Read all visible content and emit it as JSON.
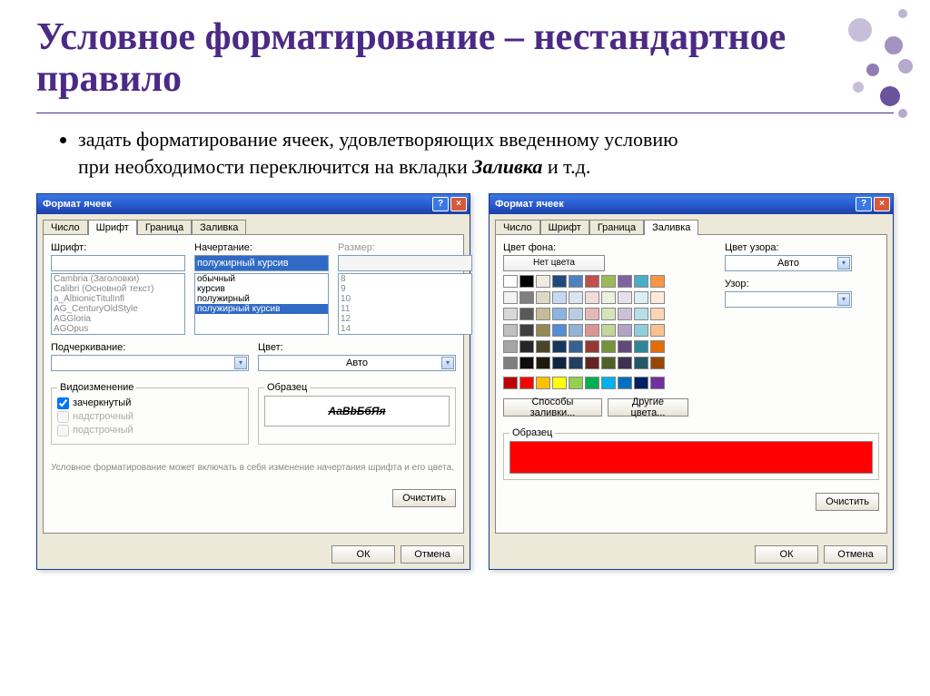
{
  "slide": {
    "title": "Условное форматирование – нестандартное правило",
    "bullet_line1": "задать форматирование ячеек, удовлетворяющих введенному условию",
    "bullet_line2": "при необходимости переключится на вкладки ",
    "bullet_emph": "Заливка",
    "bullet_tail": " и т.д."
  },
  "dialog_font": {
    "title": "Формат ячеек",
    "tabs": [
      "Число",
      "Шрифт",
      "Граница",
      "Заливка"
    ],
    "active_tab": 1,
    "font_label": "Шрифт:",
    "font_value": "",
    "font_list": [
      "Cambria (Заголовки)",
      "Calibri (Основной текст)",
      "a_AlbionicTitulInfl",
      "AG_CenturyOldStyle",
      "AGGloria",
      "AGOpus"
    ],
    "style_label": "Начертание:",
    "style_value": "полужирный курсив",
    "style_list": [
      "обычный",
      "курсив",
      "полужирный",
      "полужирный курсив"
    ],
    "size_label": "Размер:",
    "size_value": "",
    "size_list": [
      "8",
      "9",
      "10",
      "11",
      "12",
      "14"
    ],
    "underline_label": "Подчеркивание:",
    "underline_value": "",
    "color_label": "Цвет:",
    "color_value": "Авто",
    "effects_label": "Видоизменение",
    "effects": {
      "strike": "зачеркнутый",
      "super": "надстрочный",
      "sub": "подстрочный"
    },
    "sample_label": "Образец",
    "sample_text": "АаВbБбЯя",
    "note": "Условное форматирование может включать в себя изменение начертания шрифта и его цвета.",
    "clear_btn": "Очистить",
    "ok": "ОК",
    "cancel": "Отмена"
  },
  "dialog_fill": {
    "title": "Формат ячеек",
    "tabs": [
      "Число",
      "Шрифт",
      "Граница",
      "Заливка"
    ],
    "active_tab": 3,
    "bgcolor_label": "Цвет фона:",
    "nocolor": "Нет цвета",
    "pattern_color_label": "Цвет узора:",
    "pattern_color_value": "Авто",
    "pattern_label": "Узор:",
    "pattern_value": "",
    "fill_methods_btn": "Способы заливки...",
    "more_colors_btn": "Другие цвета...",
    "sample_label": "Образец",
    "clear_btn": "Очистить",
    "ok": "ОК",
    "cancel": "Отмена",
    "palette": [
      [
        "#ffffff",
        "#000000",
        "#eeece1",
        "#1f497d",
        "#4f81bd",
        "#c0504d",
        "#9bbb59",
        "#8064a2",
        "#4bacc6",
        "#f79646"
      ],
      [
        "#f2f2f2",
        "#7f7f7f",
        "#ddd9c3",
        "#c6d9f0",
        "#dbe5f1",
        "#f2dcdb",
        "#ebf1dd",
        "#e5e0ec",
        "#dbeef3",
        "#fdeada"
      ],
      [
        "#d8d8d8",
        "#595959",
        "#c4bd97",
        "#8db3e2",
        "#b8cce4",
        "#e5b9b7",
        "#d7e3bc",
        "#ccc1d9",
        "#b7dde8",
        "#fbd5b5"
      ],
      [
        "#bfbfbf",
        "#3f3f3f",
        "#938953",
        "#548dd4",
        "#95b3d7",
        "#d99694",
        "#c3d69b",
        "#b2a2c7",
        "#92cddc",
        "#fac08f"
      ],
      [
        "#a5a5a5",
        "#262626",
        "#494429",
        "#17365d",
        "#366092",
        "#953734",
        "#76923c",
        "#5f497a",
        "#31859b",
        "#e36c09"
      ],
      [
        "#7f7f7f",
        "#0c0c0c",
        "#1d1b10",
        "#0f243e",
        "#244061",
        "#632423",
        "#4f6128",
        "#3f3151",
        "#205867",
        "#974806"
      ]
    ],
    "standard": [
      "#c00000",
      "#ff0000",
      "#ffc000",
      "#ffff00",
      "#92d050",
      "#00b050",
      "#00b0f0",
      "#0070c0",
      "#002060",
      "#7030a0"
    ]
  }
}
